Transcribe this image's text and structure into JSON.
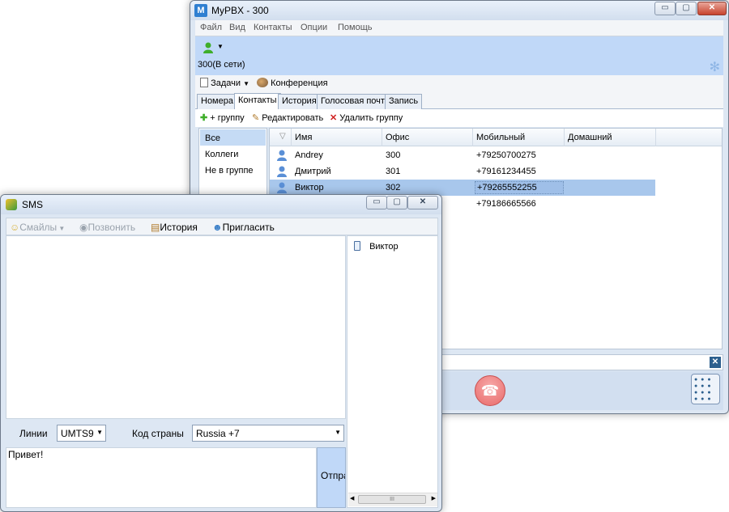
{
  "pbx": {
    "title": "MyPBX - 300",
    "app_icon_letter": "M",
    "controls": {
      "minimize": "▭",
      "maximize": "▢",
      "close": "✕"
    },
    "menu": [
      "Файл",
      "Вид",
      "Контакты",
      "Опции",
      "Помощь"
    ],
    "status_text": "300(В сети)",
    "toolbar": {
      "tasks": "Задачи",
      "conference": "Конференция"
    },
    "tabs": [
      "Номера",
      "Контакты",
      "История",
      "Голосовая почта",
      "Запись"
    ],
    "active_tab": 1,
    "actions": {
      "add_group": "+ группу",
      "edit": "Редактировать",
      "delete_group": "Удалить группу"
    },
    "groups": [
      "Все",
      "Коллеги",
      "Не в группе"
    ],
    "columns": [
      "Имя",
      "Офис",
      "Мобильный",
      "Домашний"
    ],
    "contacts": [
      {
        "name": "Andrey",
        "office": "300",
        "mobile": "+79250700275",
        "home": ""
      },
      {
        "name": "Дмитрий",
        "office": "301",
        "mobile": "+79161234455",
        "home": ""
      },
      {
        "name": "Виктор",
        "office": "302",
        "mobile": "+79265552255",
        "home": ""
      },
      {
        "name": "",
        "office": "",
        "mobile": "+79186665566",
        "home": ""
      }
    ],
    "selected_contact": 2,
    "colors": {
      "accent": "#c0d8f8",
      "selection": "#a8c7ec",
      "hangup": "#e86a6a"
    }
  },
  "sms": {
    "title": "SMS",
    "toolbar": {
      "smiles": "Смайлы",
      "call": "Позвонить",
      "history": "История",
      "invite": "Пригласить"
    },
    "recipient": "Виктор",
    "lines_label": "Линии",
    "lines_value": "UMTS9",
    "country_label": "Код страны",
    "country_value": "Russia +7",
    "message": "Привет!",
    "send_label": "Отправить",
    "scroll_mark": "III"
  }
}
